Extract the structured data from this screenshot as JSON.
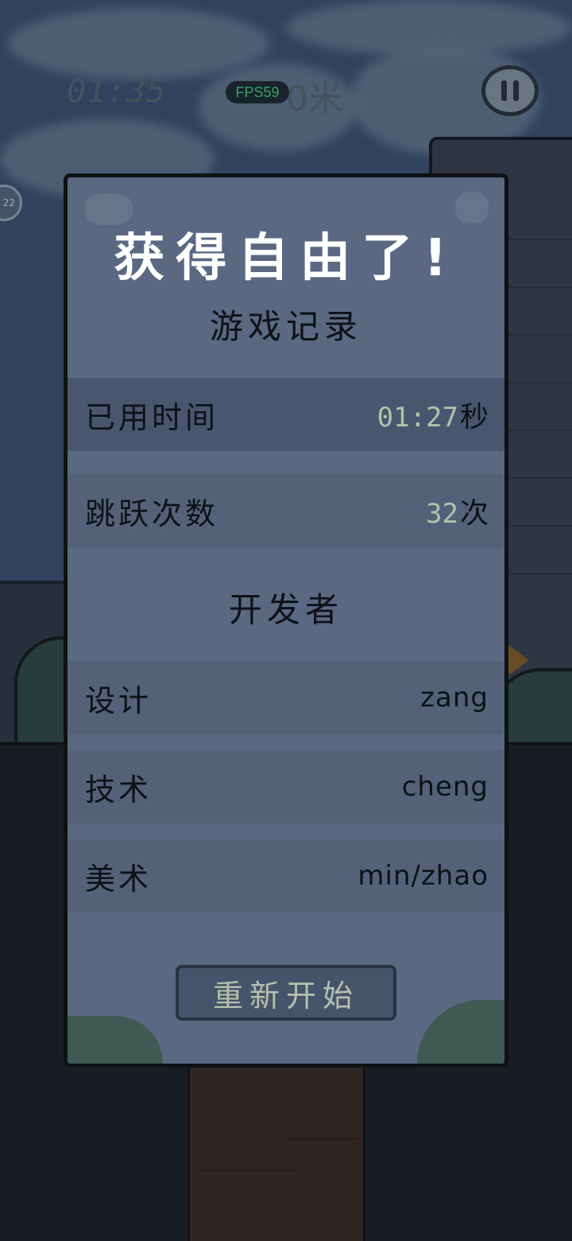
{
  "hud": {
    "time": "01:35",
    "fps": "FPS59",
    "distance": "0米",
    "pause_icon": "pause-icon"
  },
  "side_bubble": "22",
  "panel": {
    "title": "获得自由了!",
    "record_heading": "游戏记录",
    "stats": [
      {
        "label": "已用时间",
        "value": "01:27",
        "unit": "秒"
      },
      {
        "label": "跳跃次数",
        "value": "32",
        "unit": "次"
      }
    ],
    "developer_heading": "开发者",
    "credits": [
      {
        "label": "设计",
        "value": "zang"
      },
      {
        "label": "技术",
        "value": "cheng"
      },
      {
        "label": "美术",
        "value": "min/zhao"
      }
    ],
    "restart_label": "重新开始"
  },
  "colors": {
    "panel": "#5a6882",
    "accent_number": "#b7c0aa",
    "fps_text": "#3fe07a"
  }
}
